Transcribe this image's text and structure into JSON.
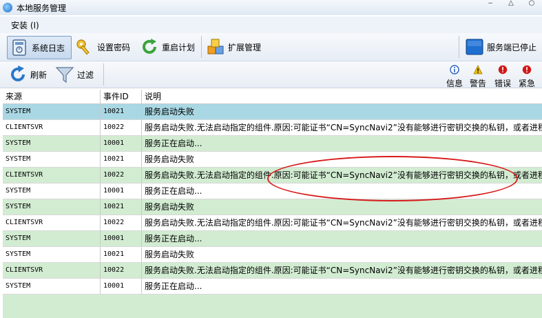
{
  "window": {
    "title": "本地服务管理",
    "minimize": "‒",
    "restore": "△",
    "close": "○"
  },
  "menu": [
    {
      "label": "安装 (I)"
    }
  ],
  "toolbar": {
    "system_log": "系统日志",
    "set_password": "设置密码",
    "restart_plan": "重启计划",
    "extension_mgmt": "扩展管理",
    "service_status": "服务端已停止"
  },
  "toolbar2": {
    "refresh": "刷新",
    "filter": "过滤",
    "levels": [
      {
        "label": "信息",
        "icon": "info-icon",
        "color": "#2a5fc0"
      },
      {
        "label": "警告",
        "icon": "warning-icon",
        "color": "#e0b000"
      },
      {
        "label": "错误",
        "icon": "error-icon",
        "color": "#d01818"
      },
      {
        "label": "紧急",
        "icon": "critical-icon",
        "color": "#d01818"
      }
    ]
  },
  "table": {
    "columns": [
      "来源",
      "事件ID",
      "说明"
    ],
    "rows": [
      {
        "source": "SYSTEM",
        "event_id": "10021",
        "desc": "服务启动失败",
        "style": "sel"
      },
      {
        "source": "CLIENTSVR",
        "event_id": "10022",
        "desc": "服务启动失败.无法启动指定的组件.原因:可能证书“CN=SyncNavi2”没有能够进行密钥交换的私钥，或者进程",
        "style": "white"
      },
      {
        "source": "SYSTEM",
        "event_id": "10001",
        "desc": "服务正在启动...",
        "style": "green"
      },
      {
        "source": "SYSTEM",
        "event_id": "10021",
        "desc": "服务启动失败",
        "style": "white"
      },
      {
        "source": "CLIENTSVR",
        "event_id": "10022",
        "desc": "服务启动失败.无法启动指定的组件.原因:可能证书“CN=SyncNavi2”没有能够进行密钥交换的私钥，或者进程",
        "style": "green"
      },
      {
        "source": "SYSTEM",
        "event_id": "10001",
        "desc": "服务正在启动...",
        "style": "white"
      },
      {
        "source": "SYSTEM",
        "event_id": "10021",
        "desc": "服务启动失败",
        "style": "green"
      },
      {
        "source": "CLIENTSVR",
        "event_id": "10022",
        "desc": "服务启动失败.无法启动指定的组件.原因:可能证书“CN=SyncNavi2”没有能够进行密钥交换的私钥，或者进程",
        "style": "white"
      },
      {
        "source": "SYSTEM",
        "event_id": "10001",
        "desc": "服务正在启动...",
        "style": "green"
      },
      {
        "source": "SYSTEM",
        "event_id": "10021",
        "desc": "服务启动失败",
        "style": "white"
      },
      {
        "source": "CLIENTSVR",
        "event_id": "10022",
        "desc": "服务启动失败.无法启动指定的组件.原因:可能证书“CN=SyncNavi2”没有能够进行密钥交换的私钥，或者进程",
        "style": "green"
      },
      {
        "source": "SYSTEM",
        "event_id": "10001",
        "desc": "服务正在启动...",
        "style": "white"
      }
    ]
  },
  "colors": {
    "annotation": "#d81a1a",
    "row_green": "#d2ecd2",
    "row_selected": "#a9d8e4"
  }
}
